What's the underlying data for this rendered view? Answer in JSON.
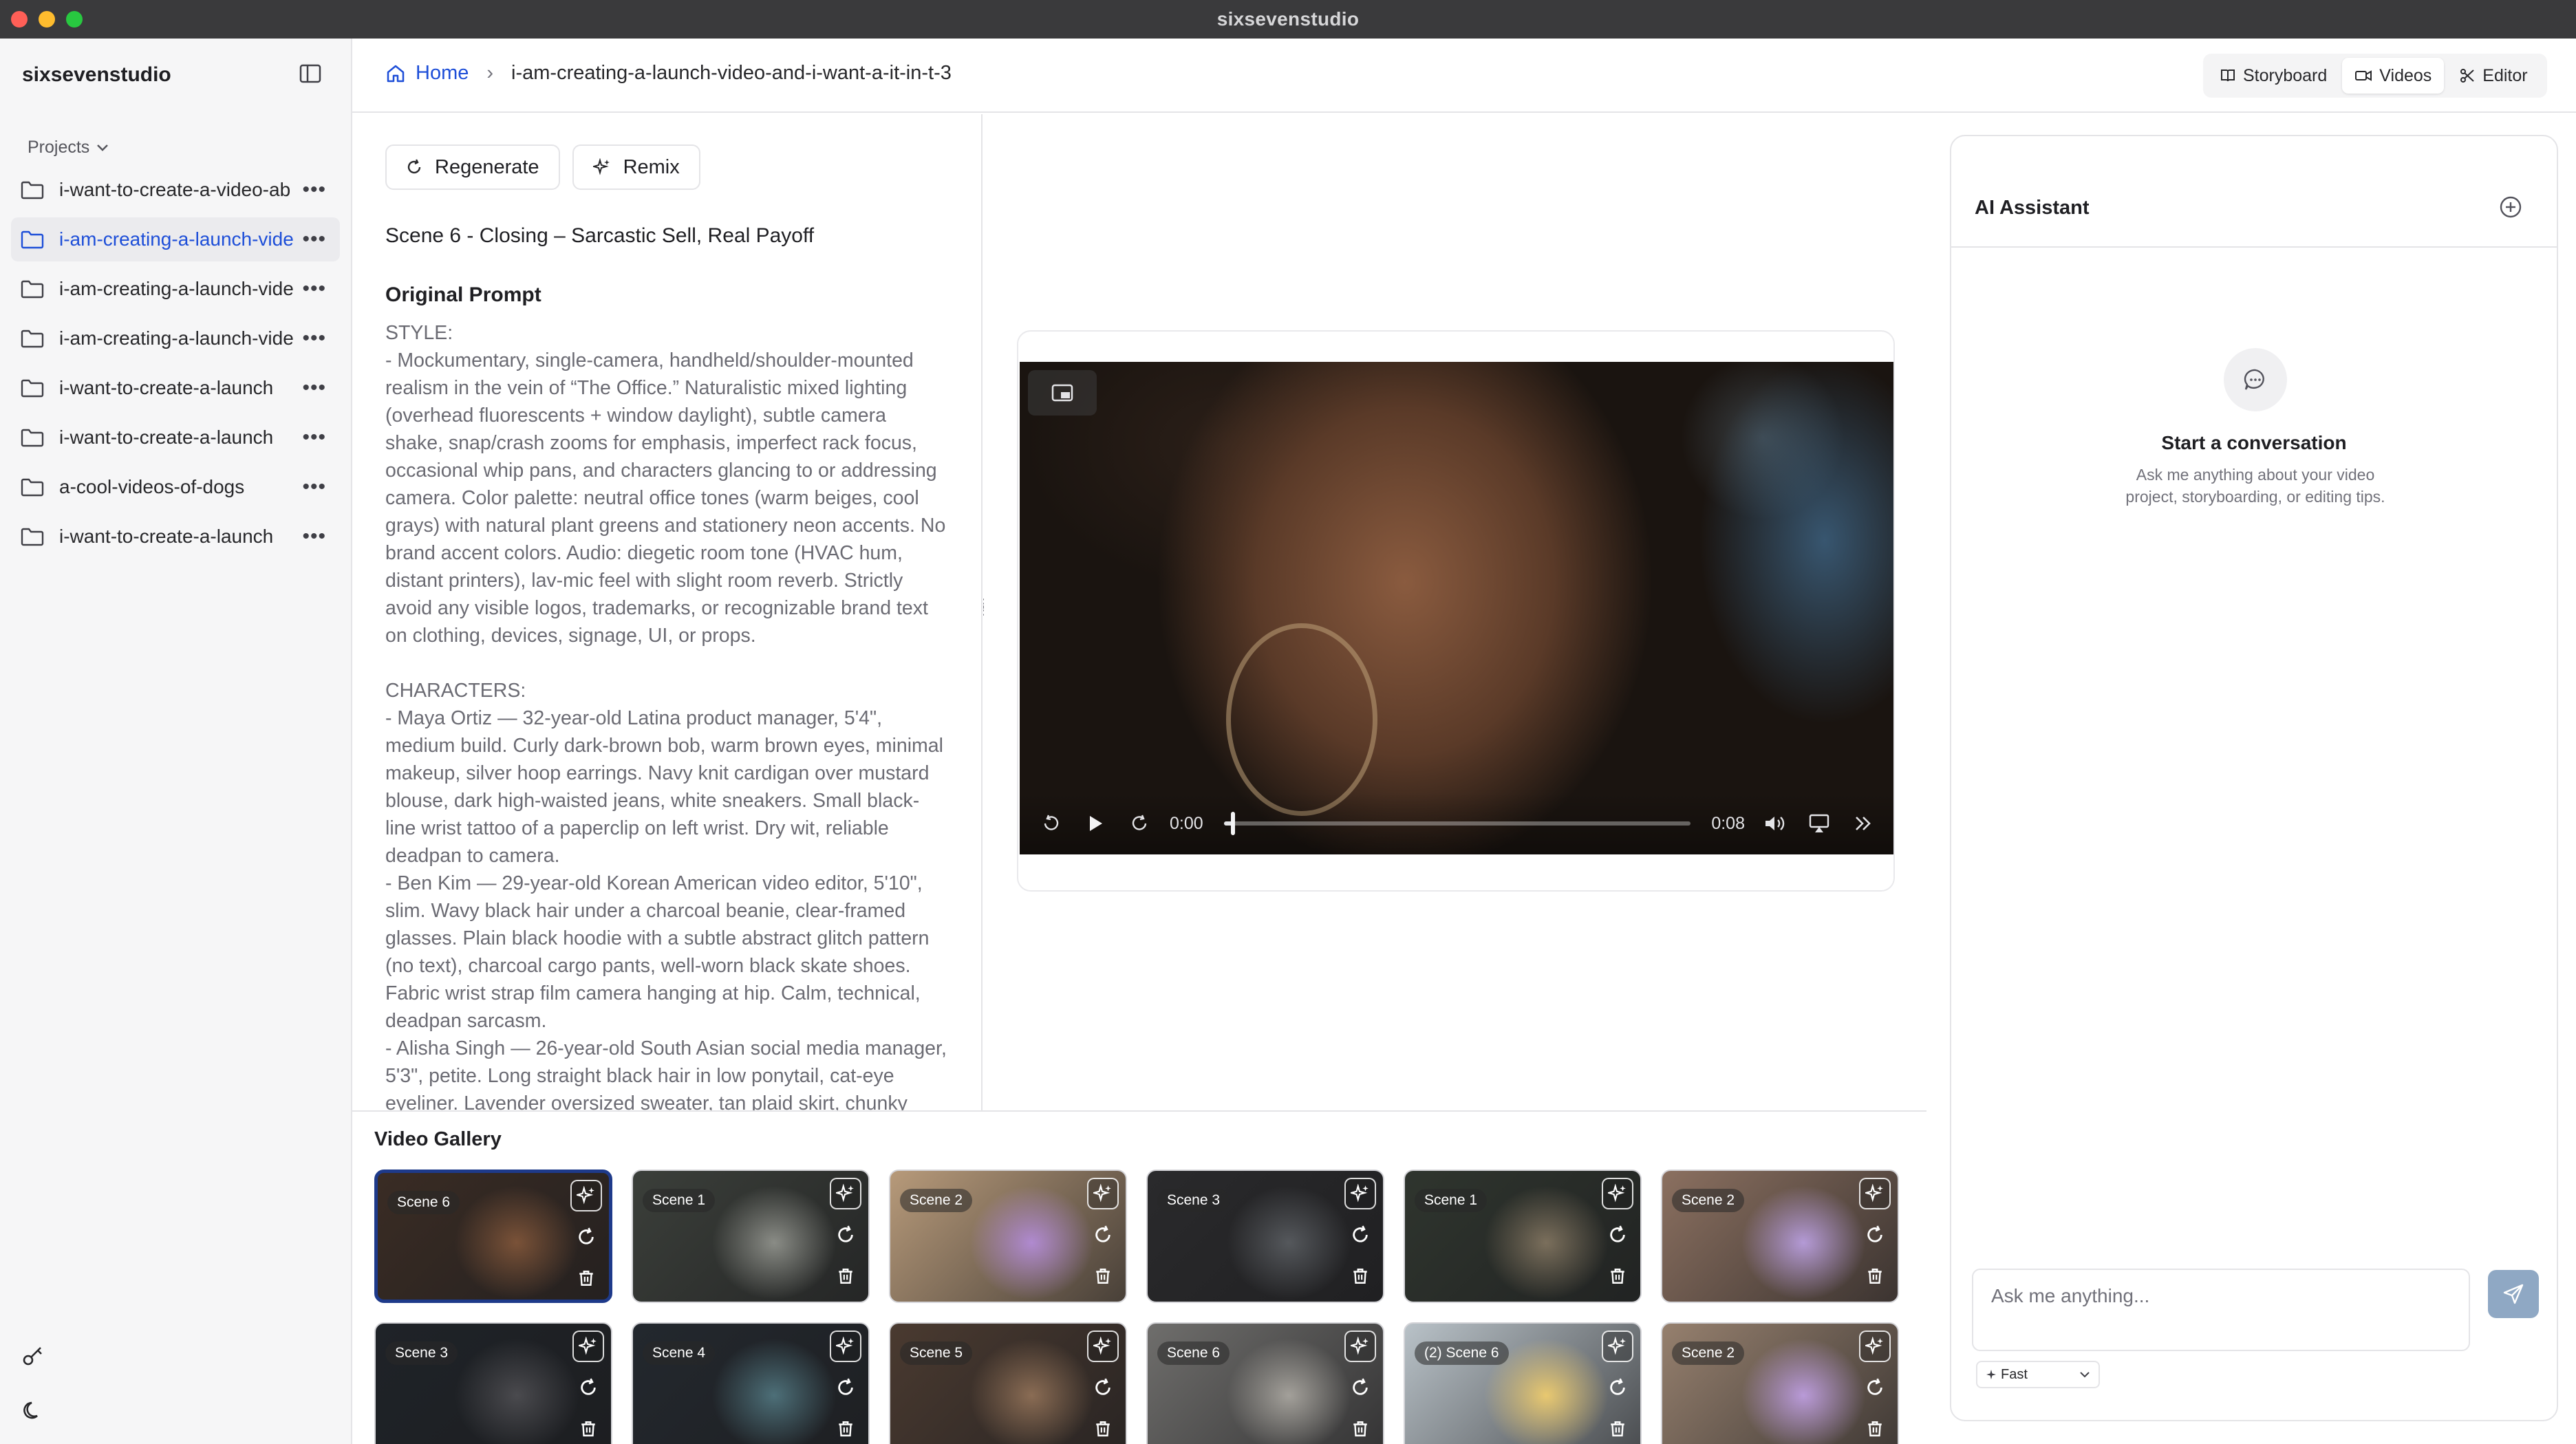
{
  "window": {
    "title": "sixsevenstudio"
  },
  "sidebar": {
    "brand": "sixsevenstudio",
    "projects_label": "Projects",
    "items": [
      {
        "label": "i-want-to-create-a-video-ab",
        "active": false
      },
      {
        "label": "i-am-creating-a-launch-vide",
        "active": true
      },
      {
        "label": "i-am-creating-a-launch-vide",
        "active": false
      },
      {
        "label": "i-am-creating-a-launch-vide",
        "active": false
      },
      {
        "label": "i-want-to-create-a-launch",
        "active": false
      },
      {
        "label": "i-want-to-create-a-launch",
        "active": false
      },
      {
        "label": "a-cool-videos-of-dogs",
        "active": false
      },
      {
        "label": "i-want-to-create-a-launch",
        "active": false
      }
    ],
    "more_glyph": "•••"
  },
  "header": {
    "home_label": "Home",
    "separator": "›",
    "current": "i-am-creating-a-launch-video-and-i-want-a-it-in-t-3",
    "tabs": [
      {
        "label": "Storyboard",
        "active": false
      },
      {
        "label": "Videos",
        "active": true
      },
      {
        "label": "Editor",
        "active": false
      }
    ]
  },
  "prompt_panel": {
    "regenerate_label": "Regenerate",
    "remix_label": "Remix",
    "scene_title": "Scene 6 - Closing – Sarcastic Sell, Real Payoff",
    "original_prompt_label": "Original Prompt",
    "prompt_text": "STYLE:\n- Mockumentary, single-camera, handheld/shoulder-mounted\nrealism in the vein of “The Office.” Naturalistic mixed lighting\n(overhead fluorescents + window daylight), subtle camera\nshake, snap/crash zooms for emphasis, imperfect rack focus,\noccasional whip pans, and characters glancing to or addressing\ncamera. Color palette: neutral office tones (warm beiges, cool\ngrays) with natural plant greens and stationery neon accents. No\nbrand accent colors. Audio: diegetic room tone (HVAC hum,\ndistant printers), lav-mic feel with slight room reverb. Strictly\navoid any visible logos, trademarks, or recognizable brand text\non clothing, devices, signage, UI, or props.\n\nCHARACTERS:\n- Maya Ortiz — 32-year-old Latina product manager, 5'4\",\nmedium build. Curly dark-brown bob, warm brown eyes, minimal\nmakeup, silver hoop earrings. Navy knit cardigan over mustard\nblouse, dark high-waisted jeans, white sneakers. Small black-\nline wrist tattoo of a paperclip on left wrist. Dry wit, reliable\ndeadpan to camera.\n- Ben Kim — 29-year-old Korean American video editor, 5'10\",\nslim. Wavy black hair under a charcoal beanie, clear-framed\nglasses. Plain black hoodie with a subtle abstract glitch pattern\n(no text), charcoal cargo pants, well-worn black skate shoes.\nFabric wrist strap film camera hanging at hip. Calm, technical,\ndeadpan sarcasm.\n- Alisha Singh — 26-year-old South Asian social media manager,\n5'3\", petite. Long straight black hair in low ponytail, cat-eye\neyeliner. Lavender oversized sweater, tan plaid skirt, chunky"
  },
  "player": {
    "current_time": "0:00",
    "duration": "0:08",
    "progress": 0.02
  },
  "gallery": {
    "title": "Video Gallery",
    "thumbs": [
      {
        "label": "Scene 6",
        "selected": true,
        "bg": "#3a2c24",
        "accent": "#7a5238"
      },
      {
        "label": "Scene 1",
        "selected": false,
        "bg": "#3b3f3a",
        "accent": "#8a8c86"
      },
      {
        "label": "Scene 2",
        "selected": false,
        "bg": "#b79a7a",
        "accent": "#b08ad0"
      },
      {
        "label": "Scene 3",
        "selected": false,
        "bg": "#2a2a2c",
        "accent": "#55585c"
      },
      {
        "label": "Scene 1",
        "selected": false,
        "bg": "#2f352e",
        "accent": "#7b6f5c"
      },
      {
        "label": "Scene 2",
        "selected": false,
        "bg": "#8b7060",
        "accent": "#b49ad6"
      },
      {
        "label": "Scene 3",
        "selected": false,
        "bg": "#1f2328",
        "accent": "#4a4a4e"
      },
      {
        "label": "Scene 4",
        "selected": false,
        "bg": "#23282e",
        "accent": "#4d6f78"
      },
      {
        "label": "Scene 5",
        "selected": false,
        "bg": "#4a3a30",
        "accent": "#8a6c54"
      },
      {
        "label": "Scene 6",
        "selected": false,
        "bg": "#6f6e6c",
        "accent": "#a3a09a"
      },
      {
        "label": "(2) Scene 6",
        "selected": false,
        "bg": "#b9c2c8",
        "accent": "#e8c870"
      },
      {
        "label": "Scene 2",
        "selected": false,
        "bg": "#96806e",
        "accent": "#b99ad8"
      }
    ]
  },
  "assistant": {
    "title": "AI Assistant",
    "empty_title": "Start a conversation",
    "empty_sub": "Ask me anything about your video project, storyboarding, or editing tips.",
    "input_placeholder": "Ask me anything...",
    "mode_label": "Fast"
  },
  "colors": {
    "accent": "#1d4ed8",
    "selected_border": "#1e3a8a",
    "send_button": "#8fa8c4"
  }
}
